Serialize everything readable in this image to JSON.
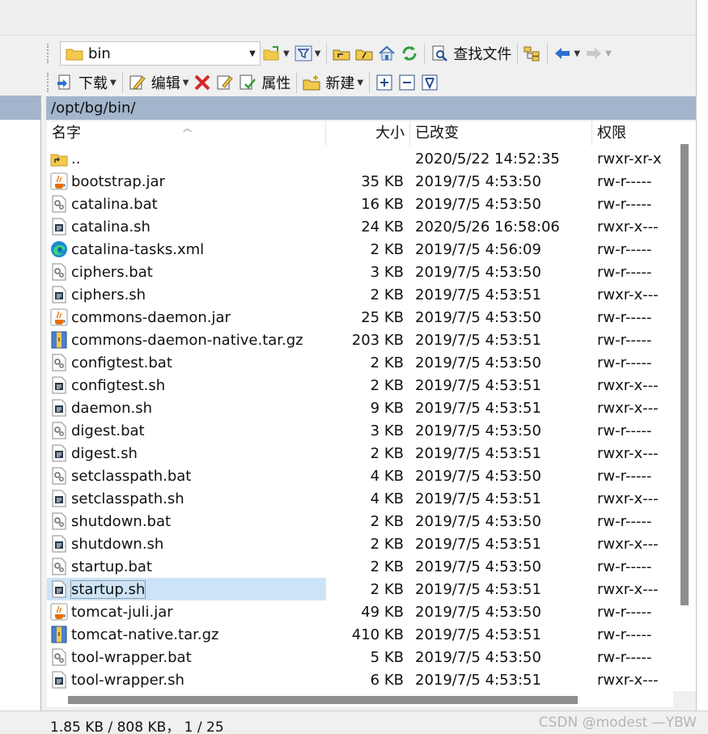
{
  "toolbar1": {
    "path_value": "bin",
    "find_files_label": "查找文件"
  },
  "toolbar2": {
    "download_label": "下载",
    "edit_label": "编辑",
    "properties_label": "属性",
    "new_label": "新建"
  },
  "address": "/opt/bg/bin/",
  "columns": {
    "name": "名字",
    "size": "大小",
    "modified": "已改变",
    "permissions": "权限"
  },
  "files": [
    {
      "name": "..",
      "size": "",
      "modified": "2020/5/22 14:52:35",
      "permissions": "rwxr-xr-x",
      "icon": "parent-folder-icon"
    },
    {
      "name": "bootstrap.jar",
      "size": "35 KB",
      "modified": "2019/7/5 4:53:50",
      "permissions": "rw-r-----",
      "icon": "java-jar-icon"
    },
    {
      "name": "catalina.bat",
      "size": "16 KB",
      "modified": "2019/7/5 4:53:50",
      "permissions": "rw-r-----",
      "icon": "bat-file-icon"
    },
    {
      "name": "catalina.sh",
      "size": "24 KB",
      "modified": "2020/5/26 16:58:06",
      "permissions": "rwxr-x---",
      "icon": "sh-file-icon"
    },
    {
      "name": "catalina-tasks.xml",
      "size": "2 KB",
      "modified": "2019/7/5 4:56:09",
      "permissions": "rw-r-----",
      "icon": "xml-edge-icon"
    },
    {
      "name": "ciphers.bat",
      "size": "3 KB",
      "modified": "2019/7/5 4:53:50",
      "permissions": "rw-r-----",
      "icon": "bat-file-icon"
    },
    {
      "name": "ciphers.sh",
      "size": "2 KB",
      "modified": "2019/7/5 4:53:51",
      "permissions": "rwxr-x---",
      "icon": "sh-file-icon"
    },
    {
      "name": "commons-daemon.jar",
      "size": "25 KB",
      "modified": "2019/7/5 4:53:50",
      "permissions": "rw-r-----",
      "icon": "java-jar-icon"
    },
    {
      "name": "commons-daemon-native.tar.gz",
      "size": "203 KB",
      "modified": "2019/7/5 4:53:51",
      "permissions": "rw-r-----",
      "icon": "archive-icon"
    },
    {
      "name": "configtest.bat",
      "size": "2 KB",
      "modified": "2019/7/5 4:53:50",
      "permissions": "rw-r-----",
      "icon": "bat-file-icon"
    },
    {
      "name": "configtest.sh",
      "size": "2 KB",
      "modified": "2019/7/5 4:53:51",
      "permissions": "rwxr-x---",
      "icon": "sh-file-icon"
    },
    {
      "name": "daemon.sh",
      "size": "9 KB",
      "modified": "2019/7/5 4:53:51",
      "permissions": "rwxr-x---",
      "icon": "sh-file-icon"
    },
    {
      "name": "digest.bat",
      "size": "3 KB",
      "modified": "2019/7/5 4:53:50",
      "permissions": "rw-r-----",
      "icon": "bat-file-icon"
    },
    {
      "name": "digest.sh",
      "size": "2 KB",
      "modified": "2019/7/5 4:53:51",
      "permissions": "rwxr-x---",
      "icon": "sh-file-icon"
    },
    {
      "name": "setclasspath.bat",
      "size": "4 KB",
      "modified": "2019/7/5 4:53:50",
      "permissions": "rw-r-----",
      "icon": "bat-file-icon"
    },
    {
      "name": "setclasspath.sh",
      "size": "4 KB",
      "modified": "2019/7/5 4:53:51",
      "permissions": "rwxr-x---",
      "icon": "sh-file-icon"
    },
    {
      "name": "shutdown.bat",
      "size": "2 KB",
      "modified": "2019/7/5 4:53:50",
      "permissions": "rw-r-----",
      "icon": "bat-file-icon"
    },
    {
      "name": "shutdown.sh",
      "size": "2 KB",
      "modified": "2019/7/5 4:53:51",
      "permissions": "rwxr-x---",
      "icon": "sh-file-icon"
    },
    {
      "name": "startup.bat",
      "size": "2 KB",
      "modified": "2019/7/5 4:53:50",
      "permissions": "rw-r-----",
      "icon": "bat-file-icon"
    },
    {
      "name": "startup.sh",
      "size": "2 KB",
      "modified": "2019/7/5 4:53:51",
      "permissions": "rwxr-x---",
      "icon": "sh-file-icon",
      "selected": true
    },
    {
      "name": "tomcat-juli.jar",
      "size": "49 KB",
      "modified": "2019/7/5 4:53:50",
      "permissions": "rw-r-----",
      "icon": "java-jar-icon"
    },
    {
      "name": "tomcat-native.tar.gz",
      "size": "410 KB",
      "modified": "2019/7/5 4:53:51",
      "permissions": "rw-r-----",
      "icon": "archive-icon"
    },
    {
      "name": "tool-wrapper.bat",
      "size": "5 KB",
      "modified": "2019/7/5 4:53:50",
      "permissions": "rw-r-----",
      "icon": "bat-file-icon"
    },
    {
      "name": "tool-wrapper.sh",
      "size": "6 KB",
      "modified": "2019/7/5 4:53:51",
      "permissions": "rwxr-x---",
      "icon": "sh-file-icon"
    }
  ],
  "status_text": "1.85 KB / 808 KB， 1 / 25",
  "watermark": "CSDN @modest —YBW",
  "colors": {
    "address_bar": "#a3b5cc",
    "selection": "#cde4f7",
    "folder": "#f2c94c"
  }
}
